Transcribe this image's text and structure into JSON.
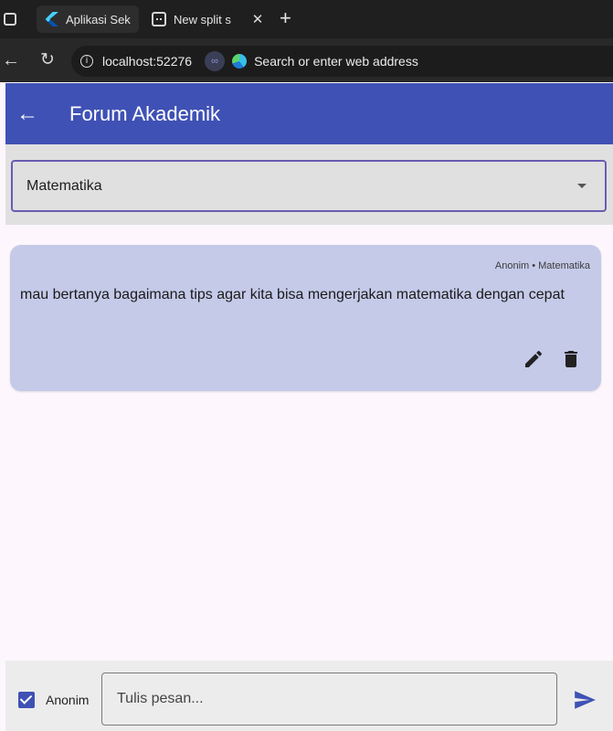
{
  "browser": {
    "tabs": [
      {
        "title": "Aplikasi Sek",
        "icon": "flutter-icon",
        "active": true
      },
      {
        "title": "New split s",
        "icon": "split-screen-icon",
        "active": false
      }
    ],
    "address": {
      "url": "localhost:52276",
      "placeholder": "Search or enter web address"
    }
  },
  "appbar": {
    "title": "Forum Akademik"
  },
  "filter": {
    "selected": "Matematika"
  },
  "messages": [
    {
      "meta": "Anonim • Matematika",
      "text": "mau bertanya bagaimana tips agar kita bisa mengerjakan matematika dengan cepat"
    }
  ],
  "composer": {
    "anon_label": "Anonim",
    "anon_checked": true,
    "placeholder": "Tulis pesan..."
  },
  "colors": {
    "primary": "#3f51b5",
    "card": "#c5cae9",
    "background": "#fdf6fd"
  }
}
